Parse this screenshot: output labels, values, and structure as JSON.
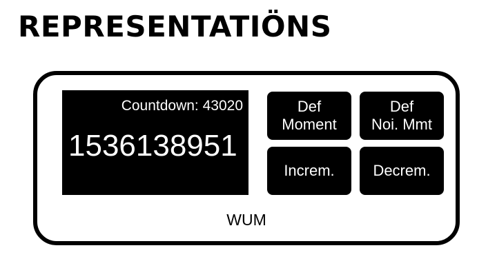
{
  "header": {
    "title": "REPRESENTATIÖNS"
  },
  "widget": {
    "countdown_label": "Countdown: 43020",
    "counter_value": "1536138951",
    "footer_label": "WUM",
    "buttons": {
      "def_moment": {
        "line1": "Def",
        "line2": "Moment"
      },
      "def_noi_mmt": {
        "line1": "Def",
        "line2": "Noi. Mmt"
      },
      "increm": {
        "label": "Increm."
      },
      "decrem": {
        "label": "Decrem."
      }
    }
  },
  "colors": {
    "background": "#ffffff",
    "foreground": "#000000",
    "button_text": "#ffffff"
  }
}
